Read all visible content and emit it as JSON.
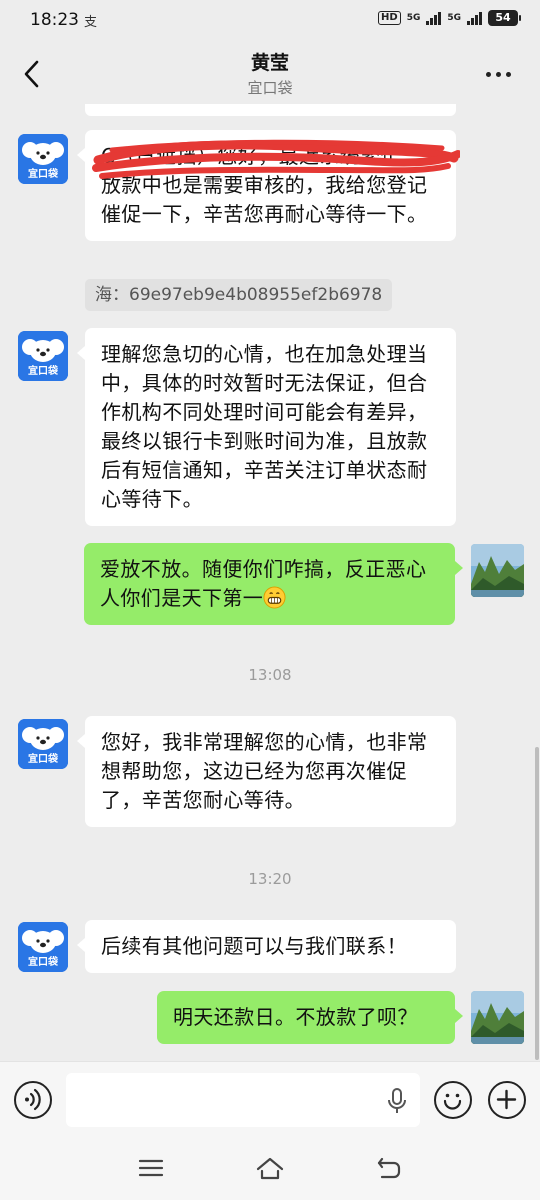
{
  "status_bar": {
    "time": "18:23",
    "app_indicator": "支",
    "hd_badge": "HD",
    "net1": "5G",
    "net2": "5G",
    "battery": "54"
  },
  "header": {
    "title": "黄莹",
    "subtitle": "宜口袋"
  },
  "avatar_left_label": "宜口袋",
  "messages": [
    {
      "side": "left",
      "text": "C（已遮挡）您好，最近系统繁忙，放款中也是需要审核的，我给您登记催促一下，辛苦您再耐心等待一下。"
    },
    {
      "side": "left",
      "text": "理解您急切的心情，也在加急处理当中，具体的时效暂时无法保证，但合作机构不同处理时间可能会有差异，最终以银行卡到账时间为准，且放款后有短信通知，辛苦关注订单状态耐心等待下。"
    },
    {
      "side": "right",
      "text": "爱放不放。随便你们咋搞，反正恶心人你们是天下第一",
      "emoji": "grinning-face"
    },
    {
      "side": "left",
      "text": "您好，我非常理解您的心情，也非常想帮助您，这边已经为您再次催促了，辛苦您耐心等待。"
    },
    {
      "side": "left",
      "text": "后续有其他问题可以与我们联系！"
    },
    {
      "side": "right",
      "text": "明天还款日。不放款了呗？"
    }
  ],
  "reference": "海：69e97eb9e4b08955ef2b6978",
  "timestamps": [
    "13:08",
    "13:20"
  ],
  "input": {
    "placeholder": ""
  },
  "colors": {
    "background": "#ededed",
    "incoming_bubble": "#ffffff",
    "outgoing_bubble": "#95ec69",
    "avatar_blue": "#2a76e5",
    "redaction": "#e53935"
  }
}
